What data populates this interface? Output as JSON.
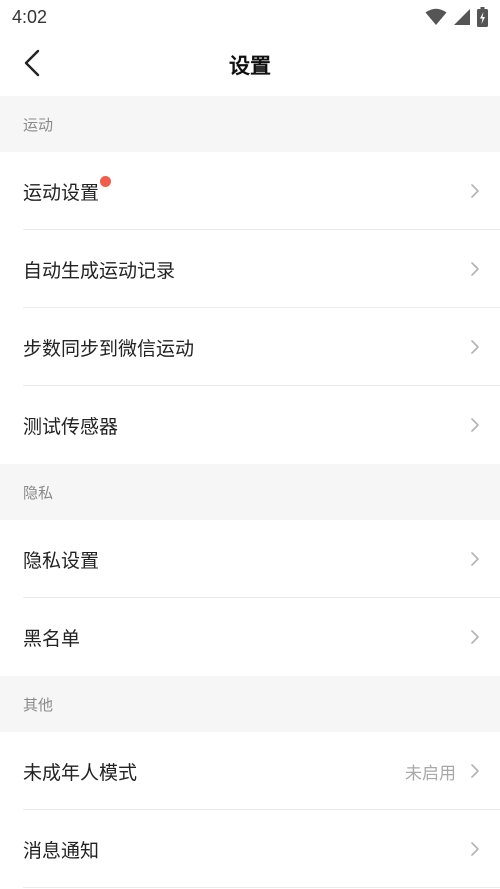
{
  "status_bar": {
    "time": "4:02",
    "icons": [
      "wifi-icon",
      "cellular-signal-icon",
      "battery-charging-icon"
    ]
  },
  "nav": {
    "title": "设置",
    "back_icon": "chevron-left-icon"
  },
  "colors": {
    "section_bg": "#f6f6f6",
    "badge_dot": "#f25c4a",
    "secondary_text": "#8a8a8a"
  },
  "sections": [
    {
      "header": "运动",
      "items": [
        {
          "label": "运动设置",
          "badge": true,
          "value": ""
        },
        {
          "label": "自动生成运动记录",
          "badge": false,
          "value": ""
        },
        {
          "label": "步数同步到微信运动",
          "badge": false,
          "value": ""
        },
        {
          "label": "测试传感器",
          "badge": false,
          "value": ""
        }
      ]
    },
    {
      "header": "隐私",
      "items": [
        {
          "label": "隐私设置",
          "badge": false,
          "value": ""
        },
        {
          "label": "黑名单",
          "badge": false,
          "value": ""
        }
      ]
    },
    {
      "header": "其他",
      "items": [
        {
          "label": "未成年人模式",
          "badge": false,
          "value": "未启用"
        },
        {
          "label": "消息通知",
          "badge": false,
          "value": ""
        }
      ]
    }
  ]
}
